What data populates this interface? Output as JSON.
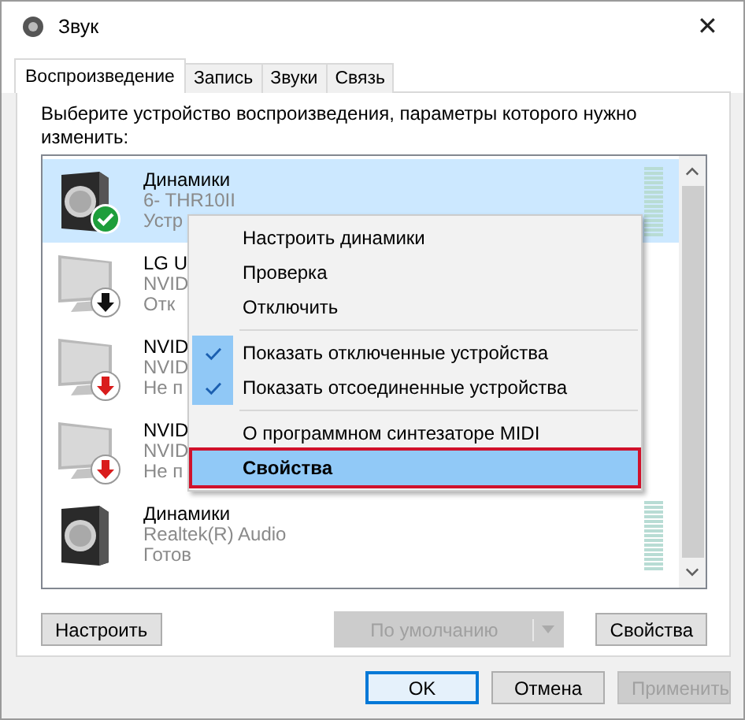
{
  "window": {
    "title": "Звук",
    "close": "✕"
  },
  "tabs": [
    {
      "label": "Воспроизведение",
      "selected": true
    },
    {
      "label": "Запись",
      "selected": false
    },
    {
      "label": "Звуки",
      "selected": false
    },
    {
      "label": "Связь",
      "selected": false
    }
  ],
  "instruction": "Выберите устройство воспроизведения, параметры которого нужно изменить:",
  "devices": [
    {
      "kind": "speaker",
      "is_default": true,
      "disabled": false,
      "unplugged": false,
      "name": "Динамики",
      "detail": "6- THR10II",
      "state": "Устр",
      "meter": true,
      "selected": true
    },
    {
      "kind": "monitor",
      "is_default": false,
      "disabled": true,
      "unplugged": false,
      "name": "LG U",
      "detail": "NVID",
      "state": "Отк",
      "meter": false,
      "selected": false
    },
    {
      "kind": "monitor",
      "is_default": false,
      "disabled": false,
      "unplugged": true,
      "name": "NVID",
      "detail": "NVID",
      "state": "Не п",
      "meter": false,
      "selected": false
    },
    {
      "kind": "monitor",
      "is_default": false,
      "disabled": false,
      "unplugged": true,
      "name": "NVID",
      "detail": "NVID",
      "state": "Не п",
      "meter": false,
      "selected": false
    },
    {
      "kind": "speaker",
      "is_default": false,
      "disabled": false,
      "unplugged": false,
      "name": "Динамики",
      "detail": "Realtek(R) Audio",
      "state": "Готов",
      "meter": true,
      "selected": false
    }
  ],
  "context_menu": [
    {
      "kind": "item",
      "label": "Настроить динамики",
      "checked": false,
      "selected": false,
      "bold": false
    },
    {
      "kind": "item",
      "label": "Проверка",
      "checked": false,
      "selected": false,
      "bold": false
    },
    {
      "kind": "item",
      "label": "Отключить",
      "checked": false,
      "selected": false,
      "bold": false
    },
    {
      "kind": "separator"
    },
    {
      "kind": "item",
      "label": "Показать отключенные устройства",
      "checked": true,
      "selected": false,
      "bold": false
    },
    {
      "kind": "item",
      "label": "Показать отсоединенные устройства",
      "checked": true,
      "selected": false,
      "bold": false
    },
    {
      "kind": "separator"
    },
    {
      "kind": "item",
      "label": "О программном синтезаторе MIDI",
      "checked": false,
      "selected": false,
      "bold": false
    },
    {
      "kind": "item",
      "label": "Свойства",
      "checked": false,
      "selected": true,
      "bold": true
    }
  ],
  "panel_buttons": [
    {
      "kind": "plain",
      "label": "Настроить",
      "disabled": false
    },
    {
      "kind": "split",
      "label": "По умолчанию",
      "disabled": true
    },
    {
      "kind": "plain",
      "label": "Свойства",
      "disabled": false
    }
  ],
  "dialog_buttons": [
    {
      "label": "OK",
      "disabled": false,
      "default": true
    },
    {
      "label": "Отмена",
      "disabled": false,
      "default": false
    },
    {
      "label": "Применить",
      "disabled": true,
      "default": false
    }
  ]
}
